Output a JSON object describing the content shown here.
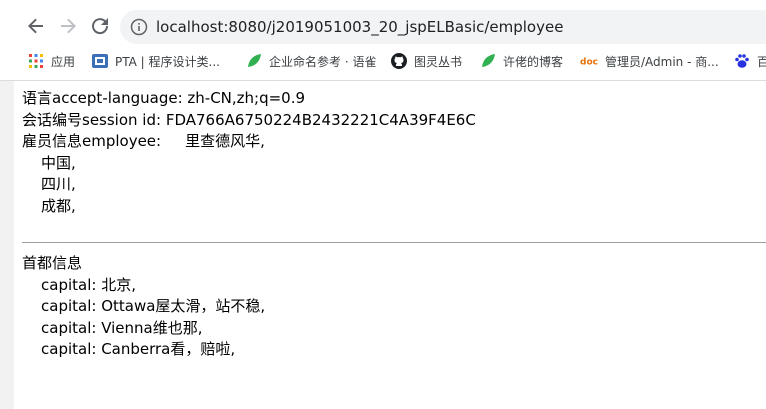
{
  "browser": {
    "url": "localhost:8080/j2019051003_20_jspELBasic/employee"
  },
  "bookmarks": [
    {
      "label": "应用",
      "icon": "apps-grid-icon"
    },
    {
      "label": "PTA | 程序设计类...",
      "icon": "pta-icon"
    },
    {
      "label": "企业命名参考 · 语雀",
      "icon": "yuque-leaf-icon"
    },
    {
      "label": "图灵丛书",
      "icon": "github-icon"
    },
    {
      "label": "许佬的博客",
      "icon": "leaf-icon"
    },
    {
      "label": "管理员/Admin - 商...",
      "icon": "doc-icon"
    },
    {
      "label": "百",
      "icon": "baidu-paw-icon"
    }
  ],
  "page": {
    "language": {
      "label": "语言accept-language:",
      "value": "zh-CN,zh;q=0.9"
    },
    "session": {
      "label": "会话编号session id:",
      "value": "FDA766A6750224B2432221C4A39F4E6C"
    },
    "employee": {
      "label": "雇员信息employee:",
      "name": "里查德风华,"
    },
    "addresses": [
      "中国,",
      "四川,",
      "成都,"
    ],
    "capital_heading": "首都信息",
    "capitals": [
      "capital: 北京,",
      "capital: Ottawa屋太滑，站不稳,",
      "capital: Vienna维也那,",
      "capital: Canberra看，赔啦,"
    ]
  }
}
